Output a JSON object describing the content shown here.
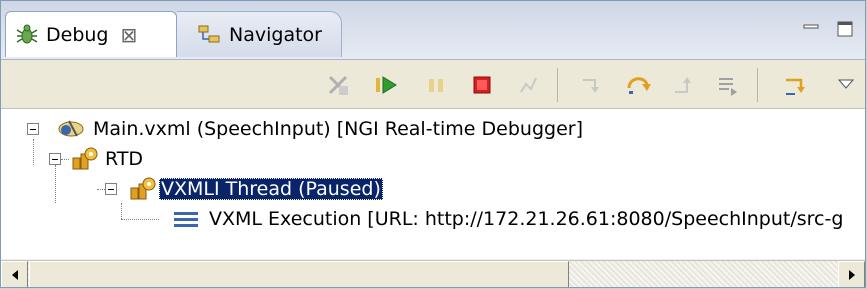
{
  "tabs": [
    {
      "label": "Debug",
      "icon": "debug-bug-icon",
      "active": true,
      "close_glyph": "⊠"
    },
    {
      "label": "Navigator",
      "icon": "navigator-icon",
      "active": false
    }
  ],
  "window_controls": [
    "minimize-icon",
    "maximize-icon"
  ],
  "toolbar": {
    "buttons": [
      "remove-terminated-icon",
      "resume-icon",
      "suspend-icon",
      "terminate-icon",
      "disconnect-icon",
      "step-into-icon",
      "step-over-icon",
      "step-return-icon",
      "drop-to-frame-icon",
      "use-step-filters-icon",
      "view-menu-icon"
    ]
  },
  "tree": {
    "launch": "Main.vxml (SpeechInput) [NGI Real-time Debugger]",
    "target": "RTD",
    "thread": "VXMLI Thread (Paused)",
    "frame": "VXML Execution [URL: http://172.21.26.61:8080/SpeechInput/src-g"
  },
  "colors": {
    "selection": "#0a246a",
    "tab_border": "#8fa3c3",
    "resume_green": "#2f9e2f",
    "terminate_red": "#d42020"
  }
}
